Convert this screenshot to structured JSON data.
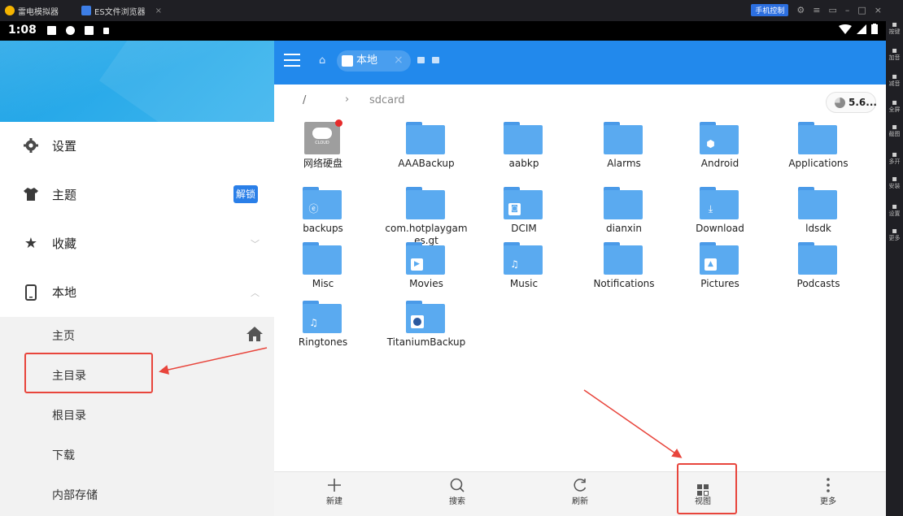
{
  "emulator": {
    "app_name": "雷电模拟器",
    "tab_title": "ES文件浏览器",
    "phone_control": "手机控制",
    "side_tools": [
      {
        "label": "按键",
        "icon": "keyboard-icon"
      },
      {
        "label": "加音",
        "icon": "volume-up-icon"
      },
      {
        "label": "减音",
        "icon": "volume-down-icon"
      },
      {
        "label": "全屏",
        "icon": "fullscreen-icon"
      },
      {
        "label": "截图",
        "icon": "screenshot-icon"
      },
      {
        "label": "多开",
        "icon": "multi-instance-icon"
      },
      {
        "label": "安装",
        "icon": "install-icon"
      },
      {
        "label": "设置",
        "icon": "settings-icon"
      },
      {
        "label": "更多",
        "icon": "more-icon"
      }
    ]
  },
  "status_bar": {
    "time": "1:08"
  },
  "drawer": {
    "items": [
      {
        "icon": "gear-icon",
        "label": "设置"
      },
      {
        "icon": "shirt-icon",
        "label": "主题",
        "badge": "解锁"
      },
      {
        "icon": "star-icon",
        "label": "收藏",
        "chevron": "﹀"
      },
      {
        "icon": "phone-icon",
        "label": "本地",
        "chevron": "︿"
      }
    ],
    "sub_items": [
      {
        "label": "主页"
      },
      {
        "label": "主目录"
      },
      {
        "label": "根目录"
      },
      {
        "label": "下载"
      },
      {
        "label": "内部存储"
      }
    ]
  },
  "toolbar": {
    "tab_label": "本地"
  },
  "path": {
    "root": "/",
    "current": "sdcard",
    "storage": "5.6..."
  },
  "files": [
    {
      "name": "网络硬盘",
      "kind": "cloud",
      "cloud_text": "CLOUD"
    },
    {
      "name": "AAABackup",
      "kind": "folder"
    },
    {
      "name": "aabkp",
      "kind": "folder"
    },
    {
      "name": "Alarms",
      "kind": "folder"
    },
    {
      "name": "Android",
      "kind": "folder",
      "overlay": "android-icon"
    },
    {
      "name": "Applications",
      "kind": "folder"
    },
    {
      "name": "backups",
      "kind": "folder",
      "overlay": "es-logo-icon"
    },
    {
      "name": "com.hotplaygames.gt",
      "kind": "folder"
    },
    {
      "name": "DCIM",
      "kind": "folder",
      "overlay": "camera-icon"
    },
    {
      "name": "dianxin",
      "kind": "folder"
    },
    {
      "name": "Download",
      "kind": "folder",
      "overlay": "download-icon"
    },
    {
      "name": "ldsdk",
      "kind": "folder"
    },
    {
      "name": "Misc",
      "kind": "folder"
    },
    {
      "name": "Movies",
      "kind": "folder",
      "overlay": "play-icon"
    },
    {
      "name": "Music",
      "kind": "folder",
      "overlay": "music-note-icon"
    },
    {
      "name": "Notifications",
      "kind": "folder"
    },
    {
      "name": "Pictures",
      "kind": "folder",
      "overlay": "image-icon"
    },
    {
      "name": "Podcasts",
      "kind": "folder"
    },
    {
      "name": "Ringtones",
      "kind": "folder",
      "overlay": "music-note-icon"
    },
    {
      "name": "TitaniumBackup",
      "kind": "folder",
      "overlay": "titanium-icon"
    }
  ],
  "bottom_bar": [
    {
      "label": "新建",
      "icon": "plus-icon"
    },
    {
      "label": "搜索",
      "icon": "search-icon"
    },
    {
      "label": "刷新",
      "icon": "refresh-icon"
    },
    {
      "label": "视图",
      "icon": "view-grid-icon"
    },
    {
      "label": "更多",
      "icon": "more-vertical-icon"
    }
  ],
  "colors": {
    "toolbar": "#2289ec",
    "folder": "#5aaaf0",
    "annotation": "#e8453c",
    "badge": "#2a7fe8"
  }
}
